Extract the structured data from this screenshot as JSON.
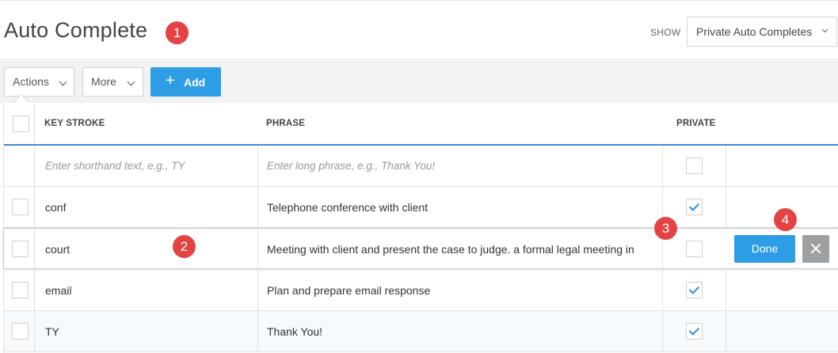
{
  "header": {
    "title": "Auto Complete",
    "show_label": "SHOW",
    "show_value": "Private Auto Completes"
  },
  "toolbar": {
    "actions_label": "Actions",
    "more_label": "More",
    "add_label": "Add",
    "add_icon": "+"
  },
  "table": {
    "columns": [
      "KEY STROKE",
      "PHRASE",
      "PRIVATE"
    ],
    "new_row": {
      "key_placeholder": "Enter shorthand text, e.g., TY",
      "phrase_placeholder": "Enter long phrase, e.g., Thank You!"
    },
    "rows": [
      {
        "key": "conf",
        "phrase": "Telephone conference with client",
        "private": true
      },
      {
        "key": "court",
        "phrase": "Meeting with client and present the case to judge. a formal legal meeting in",
        "private": false
      },
      {
        "key": "email",
        "phrase": "Plan and prepare email response",
        "private": true
      },
      {
        "key": "TY",
        "phrase": "Thank You!",
        "private": true
      }
    ],
    "done_label": "Done"
  },
  "annotations": [
    "1",
    "2",
    "3",
    "4"
  ],
  "colors": {
    "accent": "#2d9ee6",
    "badge": "#e54343",
    "header_rule": "#3d8fd6"
  }
}
